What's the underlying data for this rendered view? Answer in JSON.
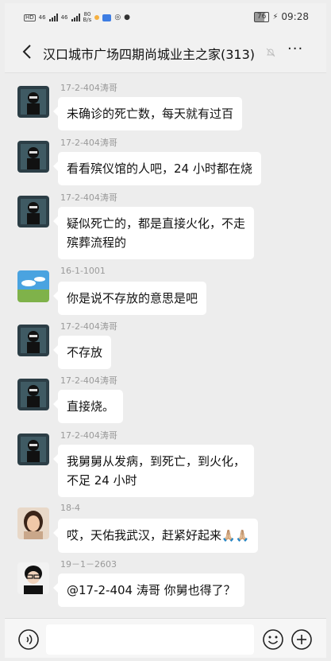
{
  "status_bar": {
    "time": "09:28",
    "battery": "76",
    "network_speed_value": "80",
    "network_speed_unit": "B/s",
    "hd_label": "HD",
    "sim1_label": "46",
    "sim2_label": "46"
  },
  "header": {
    "title": "汉口城市广场四期尚城业主之家(313)",
    "more_label": "···"
  },
  "messages": [
    {
      "sender": "17-2-404涛哥",
      "lines": [
        "未确诊的死亡数，每天就有过百"
      ],
      "avatar": "dark-figure"
    },
    {
      "sender": "17-2-404涛哥",
      "lines": [
        "看看殡仪馆的人吧，24 小时都在烧"
      ],
      "avatar": "dark-figure"
    },
    {
      "sender": "17-2-404涛哥",
      "lines": [
        "疑似死亡的，都是直接火化，不走",
        "殡葬流程的"
      ],
      "avatar": "dark-figure"
    },
    {
      "sender": "16-1-1001",
      "lines": [
        "你是说不存放的意思是吧"
      ],
      "avatar": "landscape"
    },
    {
      "sender": "17-2-404涛哥",
      "lines": [
        "不存放"
      ],
      "avatar": "dark-figure"
    },
    {
      "sender": "17-2-404涛哥",
      "lines": [
        "直接烧。"
      ],
      "avatar": "dark-figure"
    },
    {
      "sender": "17-2-404涛哥",
      "lines": [
        "我舅舅从发病，到死亡，到火化，",
        "不足 24 小时"
      ],
      "avatar": "dark-figure"
    },
    {
      "sender": "18-4",
      "lines": [
        "哎，天佑我武汉，赶紧好起来"
      ],
      "emoji": "🙏🏼🙏🏼",
      "avatar": "woman"
    },
    {
      "sender": "19－1－2603",
      "lines": [
        "@17-2-404 涛哥  你舅也得了？"
      ],
      "avatar": "glasses-person"
    }
  ],
  "colors": {
    "background": "#ededed",
    "bubble": "#ffffff",
    "sender_text": "#9a9a9a"
  }
}
